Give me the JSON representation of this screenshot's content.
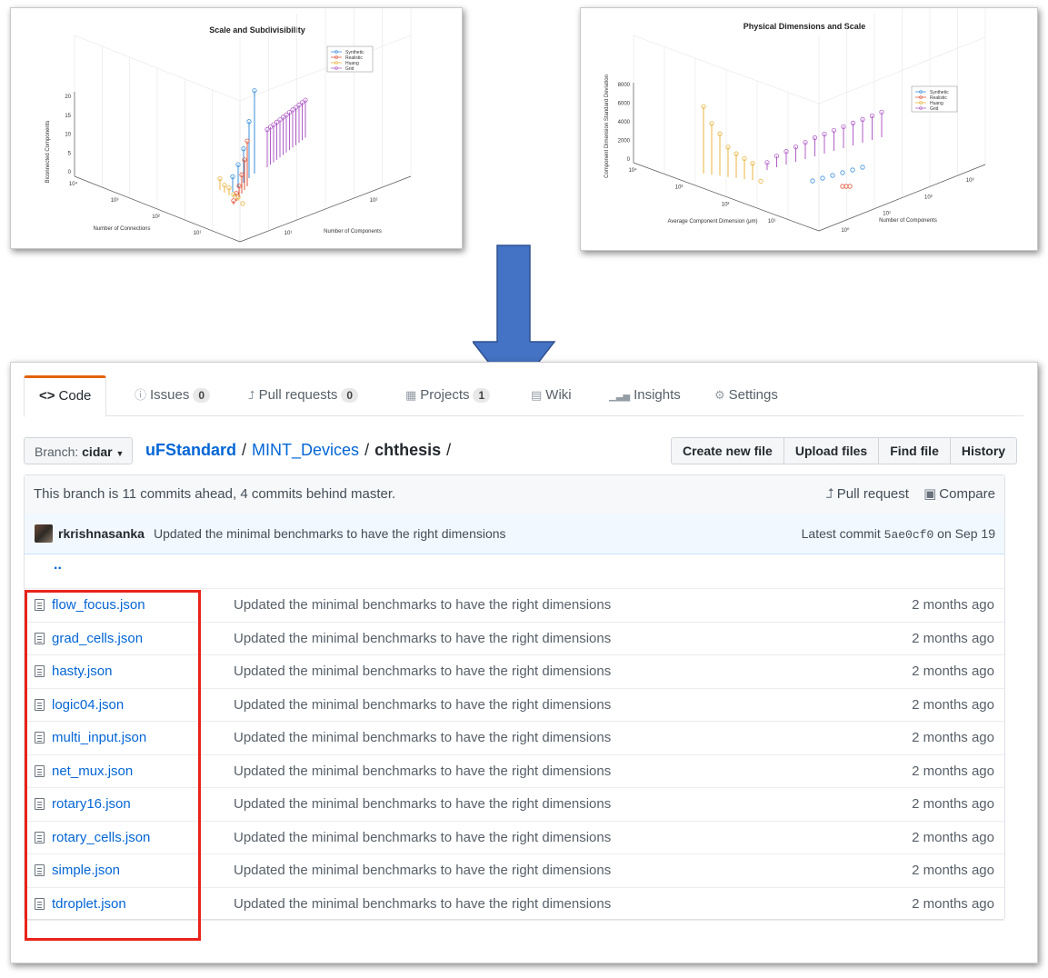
{
  "charts": [
    {
      "title": "Scale and Subdivisibility",
      "zlabel": "Biconnected Components",
      "xlabel": "Number of Connections",
      "ylabel": "Number of Components",
      "z_ticks": [
        "20",
        "15",
        "10",
        "5",
        "0"
      ],
      "x_ticks": [
        "10⁴",
        "10³",
        "10²",
        "10¹"
      ],
      "y_ticks": [
        "10²",
        "10¹"
      ],
      "legend": [
        "Synthetic",
        "Realistic",
        "Huang",
        "Grid"
      ]
    },
    {
      "title": "Physical Dimensions and Scale",
      "zlabel": "Component Dimension Standard Deviation",
      "xlabel": "Average Component Dimension (μm)",
      "ylabel": "Number of Components",
      "z_ticks": [
        "8000",
        "6000",
        "4000",
        "2000",
        "0"
      ],
      "x_ticks": [
        "10⁴",
        "10³",
        "10²",
        "10¹"
      ],
      "y_ticks": [
        "10³",
        "10²",
        "10¹",
        "10⁰"
      ],
      "legend": [
        "Synthetic",
        "Realistic",
        "Huang",
        "Grid"
      ]
    }
  ],
  "chart_data": [
    {
      "type": "scatter",
      "title": "Scale and Subdivisibility",
      "zlabel": "Biconnected Components",
      "xlabel": "Number of Connections",
      "ylabel": "Number of Components",
      "series": [
        {
          "name": "Synthetic",
          "color": "#3a8fd9",
          "values": [
            22,
            15,
            9,
            6,
            4
          ]
        },
        {
          "name": "Realistic",
          "color": "#e0553a",
          "values": [
            12,
            8,
            5,
            3,
            2,
            1
          ]
        },
        {
          "name": "Huang",
          "color": "#e8b440",
          "values": [
            3,
            2,
            2,
            1,
            1,
            0
          ]
        },
        {
          "name": "Grid",
          "color": "#b05fc7",
          "values": [
            10,
            10,
            10,
            10,
            10,
            10,
            10,
            10,
            10,
            10,
            10,
            10,
            10
          ]
        }
      ]
    },
    {
      "type": "scatter",
      "title": "Physical Dimensions and Scale",
      "zlabel": "Component Dimension Standard Deviation",
      "xlabel": "Average Component Dimension (μm)",
      "ylabel": "Number of Components",
      "series": [
        {
          "name": "Synthetic",
          "color": "#3a8fd9",
          "values": [
            0,
            0,
            0,
            0,
            0,
            0
          ]
        },
        {
          "name": "Realistic",
          "color": "#e0553a",
          "values": [
            0,
            0,
            0
          ]
        },
        {
          "name": "Huang",
          "color": "#e8b440",
          "values": [
            7200,
            5500,
            4500,
            3200,
            2600,
            2200,
            1800,
            0
          ]
        },
        {
          "name": "Grid",
          "color": "#b05fc7",
          "values": [
            800,
            1200,
            1400,
            1600,
            1800,
            2000,
            2100,
            2200,
            2300,
            2400,
            2500,
            2600,
            2700
          ]
        }
      ]
    }
  ],
  "repo": {
    "tabs": [
      {
        "label": "Code",
        "icon": "<>",
        "count": ""
      },
      {
        "label": "Issues",
        "icon": "ⓘ",
        "count": "0"
      },
      {
        "label": "Pull requests",
        "icon": "⮥",
        "count": "0"
      },
      {
        "label": "Projects",
        "icon": "▦",
        "count": "1"
      },
      {
        "label": "Wiki",
        "icon": "▤",
        "count": ""
      },
      {
        "label": "Insights",
        "icon": "▁▃▅",
        "count": ""
      },
      {
        "label": "Settings",
        "icon": "⚙",
        "count": ""
      }
    ],
    "branch_label": "Branch:",
    "branch_name": "cidar",
    "breadcrumb": [
      "uFStandard",
      "MINT_Devices",
      "chthesis"
    ],
    "breadcrumb_sep": "/",
    "buttons": [
      "Create new file",
      "Upload files",
      "Find file",
      "History"
    ],
    "branch_status": "This branch is 11 commits ahead, 4 commits behind master.",
    "pull_request_label": "Pull request",
    "compare_label": "Compare",
    "commit_author": "rkrishnasanka",
    "commit_message": "Updated the minimal benchmarks to have the right dimensions",
    "latest_commit_label": "Latest commit",
    "latest_commit_sha": "5ae0cf0",
    "latest_commit_date": "on Sep 19",
    "parent_dir": "..",
    "files": [
      {
        "name": "flow_focus.json",
        "message": "Updated the minimal benchmarks to have the right dimensions",
        "age": "2 months ago"
      },
      {
        "name": "grad_cells.json",
        "message": "Updated the minimal benchmarks to have the right dimensions",
        "age": "2 months ago"
      },
      {
        "name": "hasty.json",
        "message": "Updated the minimal benchmarks to have the right dimensions",
        "age": "2 months ago"
      },
      {
        "name": "logic04.json",
        "message": "Updated the minimal benchmarks to have the right dimensions",
        "age": "2 months ago"
      },
      {
        "name": "multi_input.json",
        "message": "Updated the minimal benchmarks to have the right dimensions",
        "age": "2 months ago"
      },
      {
        "name": "net_mux.json",
        "message": "Updated the minimal benchmarks to have the right dimensions",
        "age": "2 months ago"
      },
      {
        "name": "rotary16.json",
        "message": "Updated the minimal benchmarks to have the right dimensions",
        "age": "2 months ago"
      },
      {
        "name": "rotary_cells.json",
        "message": "Updated the minimal benchmarks to have the right dimensions",
        "age": "2 months ago"
      },
      {
        "name": "simple.json",
        "message": "Updated the minimal benchmarks to have the right dimensions",
        "age": "2 months ago"
      },
      {
        "name": "tdroplet.json",
        "message": "Updated the minimal benchmarks to have the right dimensions",
        "age": "2 months ago"
      }
    ]
  },
  "colors": {
    "arrow": "#4472c4",
    "highlight": "#e8241a",
    "link": "#0366d6",
    "tab_accent": "#e36209"
  }
}
